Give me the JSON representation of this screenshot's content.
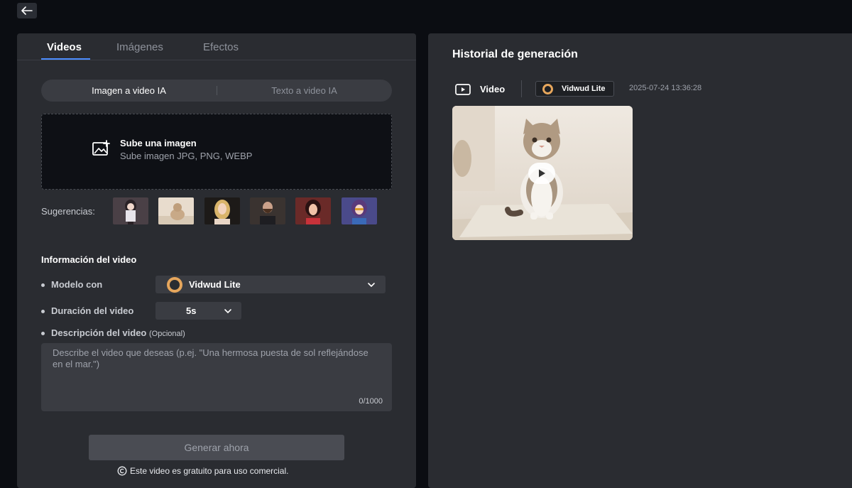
{
  "topbar": {
    "back_icon": "arrow-left-icon"
  },
  "left": {
    "tabs": [
      {
        "label": "Videos",
        "active": true
      },
      {
        "label": "Imágenes",
        "active": false
      },
      {
        "label": "Efectos",
        "active": false
      }
    ],
    "mode_toggle": {
      "active": "Imagen a video IA",
      "inactive": "Texto a video IA"
    },
    "upload": {
      "title": "Sube una imagen",
      "subtitle": "Sube imagen JPG, PNG, WEBP",
      "icon": "image-add-icon"
    },
    "suggestions": {
      "label": "Sugerencias:",
      "thumbs": [
        "anime-girl",
        "cat-on-bed",
        "blonde-woman",
        "bearded-man",
        "cartoon-woman",
        "anime-girl-glasses"
      ]
    },
    "info": {
      "title": "Información del video",
      "model_label": "Modelo con",
      "model_value": "Vidwud Lite",
      "duration_label": "Duración del video",
      "duration_value": "5s",
      "desc_label": "Descripción del video",
      "desc_optional": "(Opcional)",
      "desc_placeholder": "Describe el video que deseas (p.ej. \"Una hermosa puesta de sol reflejándose en el mar.\")",
      "desc_value": "",
      "counter": "0/1000"
    },
    "generate_button": "Generar ahora",
    "free_note": "Este video es gratuito para uso comercial."
  },
  "right": {
    "title": "Historial de generación",
    "item": {
      "type_label": "Video",
      "model": "Vidwud Lite",
      "timestamp": "2025-07-24 13:36:28"
    }
  },
  "colors": {
    "background": "#0b0d12",
    "panel": "#2a2c31",
    "accent": "#4c8dff",
    "brand_logo": "#e6a65c"
  }
}
